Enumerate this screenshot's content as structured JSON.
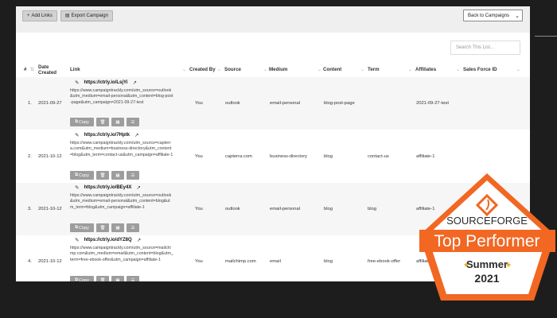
{
  "toolbar": {
    "add_links": "Add Links",
    "export_campaign": "Export Campaign",
    "back_select": "Back to Campaigns"
  },
  "search": {
    "placeholder": "Search This List..."
  },
  "columns": {
    "num": "#",
    "date": "Date Created",
    "link": "Link",
    "created_by": "Created By",
    "source": "Source",
    "medium": "Medium",
    "content": "Content",
    "term": "Term",
    "affiliates": "Affiliates",
    "sales_force_id": "Sales Force ID"
  },
  "rows": [
    {
      "index": "1.",
      "date": "2021-09-27",
      "short_url": "https://ctrly.io/LsjYi",
      "long_url": "https://www.campaigntrackly.com/utm_source=outlook&utm_medium=email-personal&utm_content=blog-post-page&utm_campaign=2021-09-27-test",
      "created_by": "You",
      "source": "outlook",
      "medium": "email-personal",
      "content": "blog-post-page",
      "term": "",
      "affiliates": "2021-09-27-test"
    },
    {
      "index": "2.",
      "date": "2021-10-12",
      "short_url": "https://ctrly.io/7Hptk",
      "long_url": "https://www.campaigntrackly.com/utm_source=capterra.com&utm_medium=business-directory&utm_content=blog&utm_term=contact-us&utm_campaign=affiliate-1",
      "created_by": "You",
      "source": "capterra.com",
      "medium": "business-directory",
      "content": "blog",
      "term": "contact-us",
      "affiliates": "affiliate-1"
    },
    {
      "index": "3.",
      "date": "2021-10-12",
      "short_url": "https://ctrly.io/BEy4X",
      "long_url": "https://www.campaigntrackly.com/utm_source=outlook&utm_medium=email-personal&utm_content=blog&utm_term=blog&utm_campaign=affiliate-1",
      "created_by": "You",
      "source": "outlook",
      "medium": "email-personal",
      "content": "blog",
      "term": "blog",
      "affiliates": "affiliate-1"
    },
    {
      "index": "4.",
      "date": "2021-10-12",
      "short_url": "https://ctrly.io/dYZ8Q",
      "long_url": "https://www.campaigntrackly.com/utm_source=mailchimp.com&utm_medium=email&utm_content=blog&utm_term=free-ebook-offer&utm_campaign=affiliate-1",
      "created_by": "You",
      "source": "mailchimp.com",
      "medium": "email",
      "content": "blog",
      "term": "free-ebook-offer",
      "affiliates": "affiliate-1"
    }
  ],
  "copy_label": "Copy",
  "badge": {
    "brand": "SOURCEFORGE",
    "title": "Top Performer",
    "season": "Summer",
    "year": "2021",
    "colors": {
      "orange": "#f26722",
      "dark": "#2b2b2b"
    }
  }
}
